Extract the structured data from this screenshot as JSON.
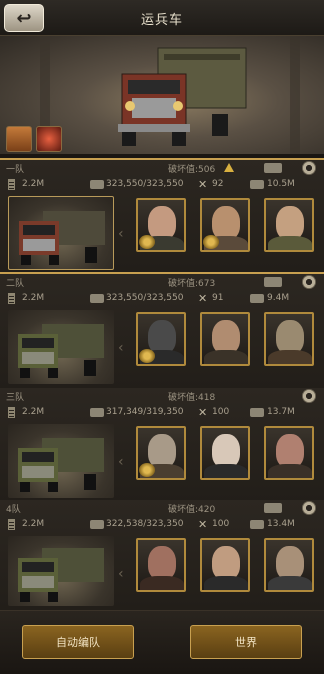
{
  "header": {
    "title": "运兵车",
    "back_icon": "back-arrow-icon"
  },
  "banner": {
    "items": [
      "book-icon",
      "fire-icon"
    ]
  },
  "squads": [
    {
      "name": "一队",
      "power_label": "破坏值:506",
      "fuel": "2.2M",
      "hp": "323,550/323,550",
      "attack": "92",
      "load": "10.5M",
      "warning": true,
      "selected": true
    },
    {
      "name": "二队",
      "power_label": "破坏值:673",
      "fuel": "2.2M",
      "hp": "323,550/323,550",
      "attack": "91",
      "load": "9.4M",
      "warning": false,
      "selected": false
    },
    {
      "name": "三队",
      "power_label": "破坏值:418",
      "fuel": "2.2M",
      "hp": "317,349/319,350",
      "attack": "100",
      "load": "13.7M",
      "warning": false,
      "selected": false
    },
    {
      "name": "4队",
      "power_label": "破坏值:420",
      "fuel": "2.2M",
      "hp": "322,538/323,350",
      "attack": "100",
      "load": "13.4M",
      "warning": false,
      "selected": false
    }
  ],
  "footer": {
    "auto_label": "自动编队",
    "world_label": "世界"
  },
  "colors": {
    "accent": "#c8a050",
    "button": "#7a561a"
  }
}
